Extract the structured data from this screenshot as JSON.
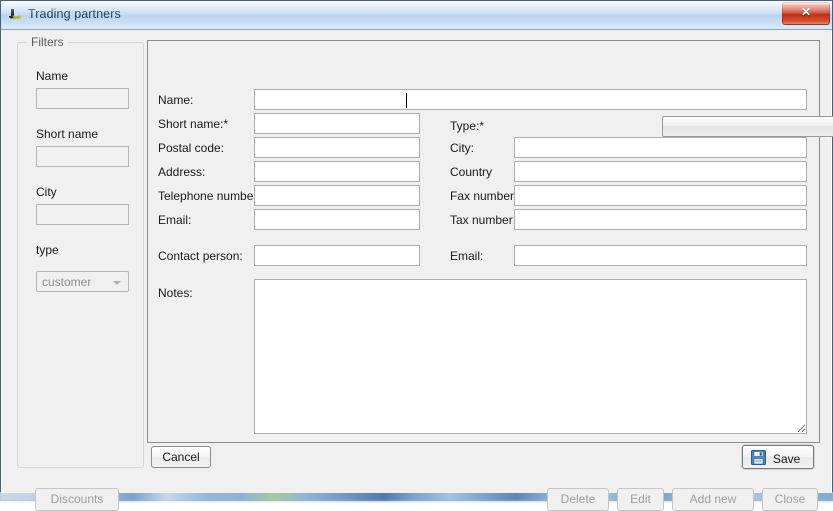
{
  "window": {
    "title": "Trading partners",
    "icon": "app-icon",
    "close_glyph": "✕"
  },
  "filters": {
    "legend": "Filters",
    "fields": [
      {
        "label": "Name",
        "value": "",
        "placeholder": "",
        "enabled": false
      },
      {
        "label": "Short name",
        "value": "",
        "placeholder": "",
        "enabled": false
      },
      {
        "label": "City",
        "value": "",
        "placeholder": "",
        "enabled": false
      }
    ],
    "type": {
      "label": "type",
      "selected": "customer",
      "options": [
        "customer"
      ],
      "enabled": false
    }
  },
  "form": {
    "left_column": [
      {
        "label": "Name:",
        "value": "",
        "focused": true
      },
      {
        "label": "Short name:*",
        "value": ""
      },
      {
        "label": "Postal code:",
        "value": ""
      },
      {
        "label": "Address:",
        "value": ""
      },
      {
        "label": "Telephone number:",
        "value": ""
      },
      {
        "label": "Email:",
        "value": ""
      },
      {
        "label": "Contact person:",
        "value": ""
      }
    ],
    "right_column": [
      {
        "label": "Type:*",
        "value": "",
        "control": "combobox"
      },
      {
        "label": "City:",
        "value": ""
      },
      {
        "label": "Country",
        "value": ""
      },
      {
        "label": "Fax number:",
        "value": ""
      },
      {
        "label": "Tax number:",
        "value": ""
      },
      {
        "label": "Email:",
        "value": ""
      }
    ],
    "notes": {
      "label": "Notes:",
      "value": ""
    }
  },
  "buttons": {
    "cancel": {
      "label": "Cancel",
      "enabled": true
    },
    "save": {
      "label": "Save",
      "enabled": true,
      "icon": "floppy-disk-icon"
    },
    "discounts": {
      "label": "Discounts",
      "enabled": false
    },
    "delete": {
      "label": "Delete",
      "enabled": false
    },
    "edit": {
      "label": "Edit",
      "enabled": false
    },
    "add_new": {
      "label": "Add new",
      "enabled": false
    },
    "close": {
      "label": "Close",
      "enabled": false
    }
  },
  "colors": {
    "titlebar_text": "#123a5e",
    "close_button": "#cf4429",
    "window_bg": "#f0f0f0",
    "field_border": "#adadad",
    "disabled_text": "#9d9d9d"
  }
}
